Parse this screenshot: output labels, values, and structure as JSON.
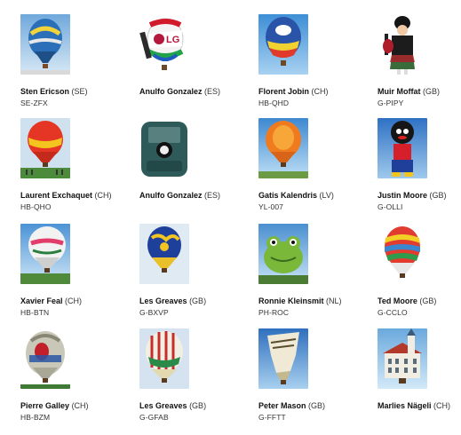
{
  "entries": [
    {
      "pilot": "Sten Ericson",
      "country": "(SE)",
      "reg": "SE-ZFX",
      "icon": "hot-air-balloon-blue-sky"
    },
    {
      "pilot": "Anulfo Gonzalez",
      "country": "(ES)",
      "reg": "",
      "icon": "lg-logo-balloon"
    },
    {
      "pilot": "Florent Jobin",
      "country": "(CH)",
      "reg": "HB-QHD",
      "icon": "hot-air-balloon-striped"
    },
    {
      "pilot": "Muir Moffat",
      "country": "(GB)",
      "reg": "G-PIPY",
      "icon": "bagpiper-shaped-balloon"
    },
    {
      "pilot": "Laurent Exchaquet",
      "country": "(CH)",
      "reg": "HB-QHO",
      "icon": "hot-air-balloon-red-yellow"
    },
    {
      "pilot": "Anulfo Gonzalez",
      "country": "(ES)",
      "reg": "",
      "icon": "phone-shaped-balloon"
    },
    {
      "pilot": "Gatis Kalendris",
      "country": "(LV)",
      "reg": "YL-007",
      "icon": "hot-air-balloon-orange"
    },
    {
      "pilot": "Justin Moore",
      "country": "(GB)",
      "reg": "G-OLLI",
      "icon": "character-shaped-balloon"
    },
    {
      "pilot": "Xavier Feal",
      "country": "(CH)",
      "reg": "HB-BTN",
      "icon": "hot-air-balloon-white-logo"
    },
    {
      "pilot": "Les Greaves",
      "country": "(GB)",
      "reg": "G-BXVP",
      "icon": "hot-air-balloon-blue-yellow"
    },
    {
      "pilot": "Ronnie Kleinsmit",
      "country": "(NL)",
      "reg": "PH-ROC",
      "icon": "frog-shaped-balloon"
    },
    {
      "pilot": "Ted Moore",
      "country": "(GB)",
      "reg": "G-CCLO",
      "icon": "hot-air-balloon-rainbow"
    },
    {
      "pilot": "Pierre Galley",
      "country": "(CH)",
      "reg": "HB-BZM",
      "icon": "bottle-shaped-balloon"
    },
    {
      "pilot": "Les Greaves",
      "country": "(GB)",
      "reg": "G-GFAB",
      "icon": "hot-air-balloon-striped-red"
    },
    {
      "pilot": "Peter Mason",
      "country": "(GB)",
      "reg": "G-FFTT",
      "icon": "banner-shaped-balloon"
    },
    {
      "pilot": "Marlies Nägeli",
      "country": "(CH)",
      "reg": "",
      "icon": "church-shaped-balloon"
    }
  ]
}
